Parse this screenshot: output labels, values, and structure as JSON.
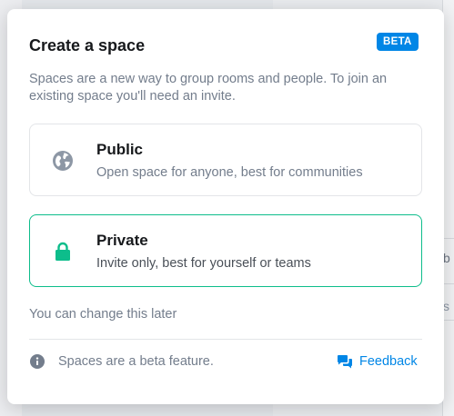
{
  "dialog": {
    "title": "Create a space",
    "badge": "BETA",
    "description": "Spaces are a new way to group rooms and people. To join an existing space you'll need an invite.",
    "options": [
      {
        "name": "Public",
        "description": "Open space for anyone, best for communities",
        "icon": "globe-icon"
      },
      {
        "name": "Private",
        "description": "Invite only, best for yourself or teams",
        "icon": "lock-icon"
      }
    ],
    "note": "You can change this later",
    "footer": {
      "info_text": "Spaces are a beta feature.",
      "feedback_label": "Feedback"
    }
  },
  "background": {
    "fragments": [
      "b",
      "s"
    ]
  },
  "colors": {
    "accent": "#0dbd8b",
    "link": "#0086e6",
    "badge_bg": "#0086e6",
    "muted_text": "#737d8c",
    "icon_gray": "#8d97a5"
  }
}
